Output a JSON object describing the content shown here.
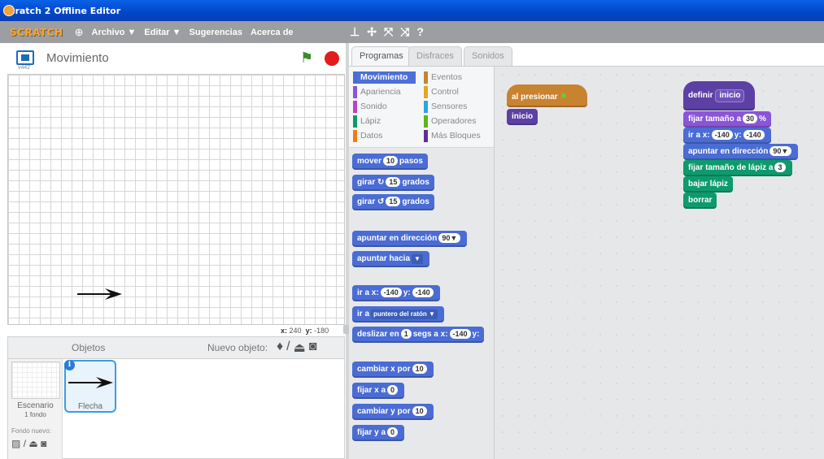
{
  "window": {
    "title": "Scratch 2 Offline Editor"
  },
  "menubar": {
    "logo": "SCRATCH",
    "items": [
      "Archivo ▼",
      "Editar ▼",
      "Sugerencias",
      "Acerca de"
    ]
  },
  "stage": {
    "project_name": "Movimiento",
    "version": "v442",
    "coords_x_label": "x:",
    "coords_x": "240",
    "coords_y_label": "y:",
    "coords_y": "-180"
  },
  "sprites_pane": {
    "title": "Objetos",
    "new_sprite_label": "Nuevo objeto:",
    "stage_label": "Escenario",
    "stage_sub": "1 fondo",
    "new_backdrop_label": "Fondo nuevo:",
    "sprite_name": "Flecha"
  },
  "tabs": [
    "Programas",
    "Disfraces",
    "Sonidos"
  ],
  "categories": {
    "left": [
      "Movimiento",
      "Apariencia",
      "Sonido",
      "Lápiz",
      "Datos"
    ],
    "right": [
      "Eventos",
      "Control",
      "Sensores",
      "Operadores",
      "Más Bloques"
    ],
    "colors_left": [
      "#4a6cd4",
      "#8a55d7",
      "#bb42c3",
      "#0e9a6c",
      "#ee7d16"
    ],
    "colors_right": [
      "#c88330",
      "#e1a91a",
      "#2ca5e2",
      "#5cb712",
      "#632d99"
    ]
  },
  "palette": {
    "mover": [
      "mover",
      "10",
      "pasos"
    ],
    "girar_r": [
      "girar",
      "15",
      "grados"
    ],
    "girar_l": [
      "girar",
      "15",
      "grados"
    ],
    "apuntar_dir": [
      "apuntar en dirección",
      "90▼"
    ],
    "apuntar_hacia": [
      "apuntar hacia",
      "▼"
    ],
    "ir_a_xy": [
      "ir a x:",
      "-140",
      "y:",
      "-140"
    ],
    "ir_a": [
      "ir a",
      "puntero del ratón ▼"
    ],
    "deslizar": [
      "deslizar en",
      "1",
      "segs a x:",
      "-140",
      "y:"
    ],
    "cambiar_x": [
      "cambiar x por",
      "10"
    ],
    "fijar_x": [
      "fijar x a",
      "0"
    ],
    "cambiar_y": [
      "cambiar y por",
      "10"
    ],
    "fijar_y": [
      "fijar y a",
      "0"
    ]
  },
  "scripts": {
    "script1": {
      "hat": "al presionar",
      "call": "inicio"
    },
    "script2": {
      "define": "definir",
      "define_name": "inicio",
      "fijar_tamano": [
        "fijar tamaño a",
        "30",
        "%"
      ],
      "ir_a": [
        "ir a x:",
        "-140",
        "y:",
        "-140"
      ],
      "apuntar": [
        "apuntar en dirección",
        "90▼"
      ],
      "lapiz_tamano": [
        "fijar tamaño de lápiz a",
        "3"
      ],
      "bajar": "bajar lápiz",
      "borrar": "borrar"
    }
  }
}
